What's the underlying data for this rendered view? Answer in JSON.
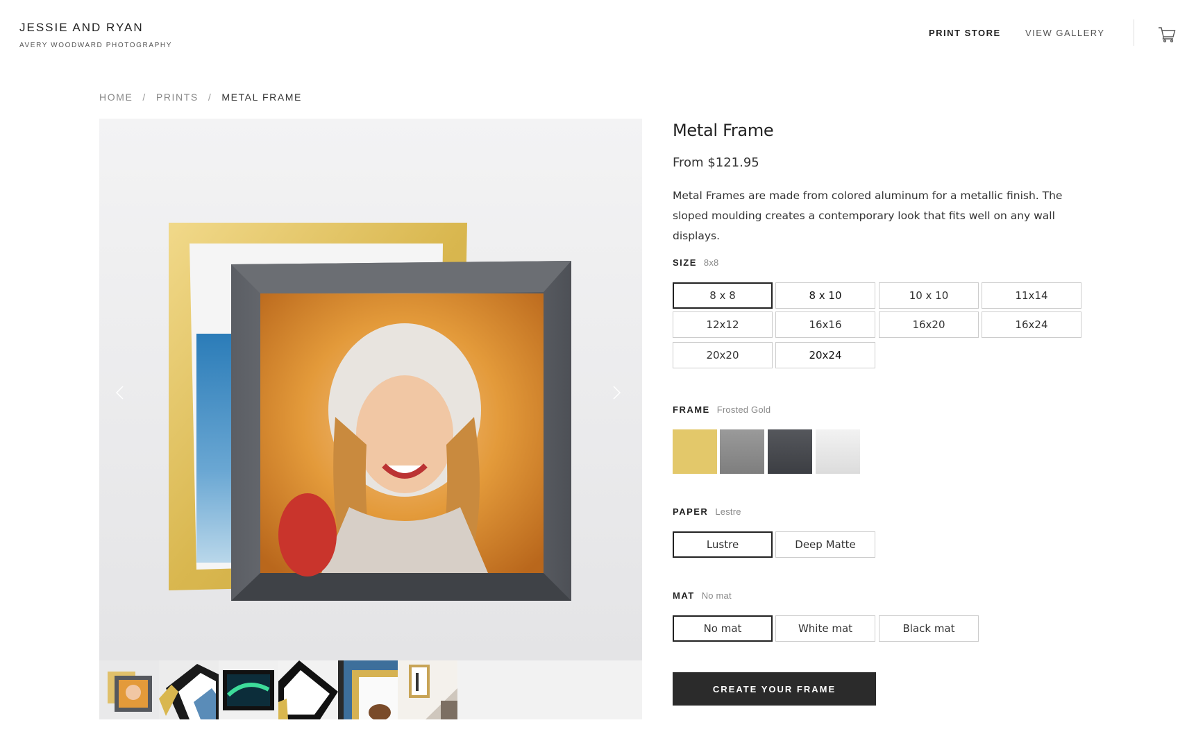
{
  "header": {
    "brand_title": "JESSIE AND RYAN",
    "brand_sub": "AVERY WOODWARD PHOTOGRAPHY",
    "nav": [
      "PRINT STORE",
      "VIEW GALLERY"
    ],
    "cart_icon": "cart-icon"
  },
  "breadcrumb": {
    "items": [
      "HOME",
      "PRINTS",
      "METAL FRAME"
    ],
    "separator": "/"
  },
  "gallery": {
    "prev_icon": "chevron-left-icon",
    "next_icon": "chevron-right-icon",
    "thumbnail_count": 6
  },
  "product": {
    "title": "Metal Frame",
    "price": "From $121.95",
    "description": "Metal Frames are made from colored aluminum for a metallic finish. The sloped moulding creates a contemporary look that fits well on any wall displays."
  },
  "size": {
    "label": "SIZE",
    "selected": "8x8",
    "options": [
      "8 x 8",
      "8 x 10",
      "10 x 10",
      "11x14",
      "12x12",
      "16x16",
      "16x20",
      "16x24",
      "20x20",
      "20x24"
    ]
  },
  "frame": {
    "label": "FRAME",
    "selected": "Frosted Gold",
    "swatch_colors": [
      "#e3c86a",
      "#8c8c8c",
      "#45474c",
      "#e8e8e8"
    ]
  },
  "paper": {
    "label": "PAPER",
    "selected": "Lestre",
    "options": [
      "Lustre",
      "Deep Matte"
    ]
  },
  "mat": {
    "label": "MAT",
    "selected": "No mat",
    "options": [
      "No mat",
      "White mat",
      "Black mat"
    ]
  },
  "cta": {
    "label": "CREATE YOUR FRAME"
  },
  "colors": {
    "accent_dark": "#2b2b2b",
    "border": "#cccccc"
  }
}
